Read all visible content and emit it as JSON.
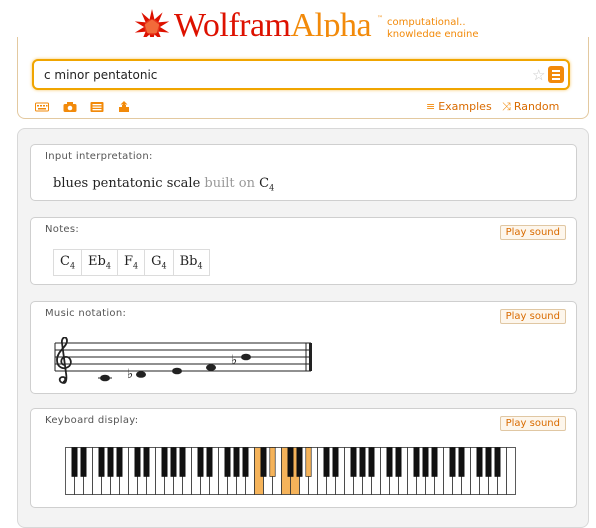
{
  "header": {
    "logo_part1": "Wolfram",
    "logo_part2": "Alpha",
    "tm": "™",
    "tagline_line1": "computational..",
    "tagline_line2": "knowledge engine"
  },
  "search": {
    "value": "c minor pentatonic",
    "favorite_glyph": "☆"
  },
  "toolbar": {
    "examples_label": "Examples",
    "random_label": "Random",
    "examples_glyph": "≡",
    "random_glyph": "⤨"
  },
  "pods": {
    "input": {
      "title": "Input interpretation:",
      "scale_name": "blues pentatonic scale",
      "connector": "built on",
      "root_note": "C",
      "root_octave": "4"
    },
    "notes": {
      "title": "Notes:",
      "play_label": "Play sound",
      "items": [
        {
          "name": "C",
          "octave": "4"
        },
        {
          "name": "Eb",
          "octave": "4"
        },
        {
          "name": "F",
          "octave": "4"
        },
        {
          "name": "G",
          "octave": "4"
        },
        {
          "name": "Bb",
          "octave": "4"
        }
      ]
    },
    "notation": {
      "title": "Music notation:",
      "play_label": "Play sound"
    },
    "keyboard": {
      "title": "Keyboard display:",
      "play_label": "Play sound",
      "highlighted_keys": [
        "C4",
        "Eb4",
        "F4",
        "G4",
        "Bb4"
      ],
      "highlight_color": "#f5b35a"
    }
  },
  "colors": {
    "brand_red": "#dd1100",
    "brand_orange": "#f28a0a"
  }
}
